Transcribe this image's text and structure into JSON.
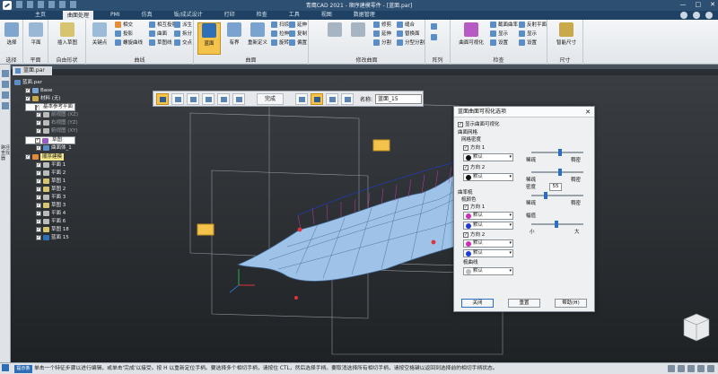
{
  "window": {
    "title": "青鹰CAD 2021 - 顺序建模零件 - [蓝面.par]",
    "controls": [
      "—",
      "□",
      "✕"
    ]
  },
  "ribbon_tabs": [
    "主页",
    "曲面处理",
    "PMI",
    "仿真",
    "钣/成式设计",
    "打印",
    "检查",
    "工具",
    "视图",
    "数据管理"
  ],
  "active_tab": "曲面处理",
  "ribbon": {
    "select": {
      "button": "选择",
      "group": "选择"
    },
    "plane": {
      "button": "平面",
      "group": "平面"
    },
    "sketch": {
      "button": "插入草图",
      "group": "自由形状"
    },
    "curves": {
      "items": [
        "相交",
        "投影",
        "螺旋曲线",
        "相互投影",
        "曲面",
        "草图线",
        "派生",
        "拆分",
        "交点",
        "关键点"
      ],
      "primary": "关键点",
      "group": "曲线"
    },
    "surfaces": {
      "buttons": [
        "蓝面",
        "有界",
        "重新定义"
      ],
      "items": [
        "扫掠",
        "拉伸",
        "旋转",
        "延伸",
        "复制",
        "偏置"
      ],
      "group": "曲面"
    },
    "modify": {
      "items": [
        "修剪",
        "延伸",
        "分割",
        "缝合",
        "替换面",
        "分型分割"
      ],
      "group": "修改曲面"
    },
    "pattern": {
      "group": "阵列"
    },
    "inspect": {
      "buttons": [
        "曲面可视化"
      ],
      "items": [
        "截面曲率",
        "显示",
        "设置",
        "反射平面",
        "显示",
        "设置"
      ],
      "group": "检查"
    },
    "dims": {
      "button": "智能尺寸",
      "group": "尺寸"
    }
  },
  "document_tab": "蓝面.par",
  "left_rail_text": "路径查找器",
  "tree": [
    {
      "label": "蓝面.par",
      "level": 0,
      "style": "normal"
    },
    {
      "label": "Base",
      "level": 1,
      "style": "normal"
    },
    {
      "label": "材料 (无)",
      "level": 1,
      "style": "normal"
    },
    {
      "label": "基本参考平面",
      "level": 1,
      "style": "sel"
    },
    {
      "label": "前视图 (XZ)",
      "level": 2,
      "style": "dim"
    },
    {
      "label": "右视图 (YZ)",
      "level": 2,
      "style": "dim"
    },
    {
      "label": "俯视图 (XY)",
      "level": 2,
      "style": "dim"
    },
    {
      "label": "草图",
      "level": 1,
      "style": "sel"
    },
    {
      "label": "曲面体_1",
      "level": 2,
      "style": "normal"
    },
    {
      "label": "顺序建模",
      "level": 1,
      "style": "hl"
    },
    {
      "label": "平面 1",
      "level": 2,
      "style": "normal"
    },
    {
      "label": "平面 2",
      "level": 2,
      "style": "normal"
    },
    {
      "label": "草图 1",
      "level": 2,
      "style": "normal"
    },
    {
      "label": "草图 2",
      "level": 2,
      "style": "normal"
    },
    {
      "label": "平面 3",
      "level": 2,
      "style": "normal"
    },
    {
      "label": "草图 3",
      "level": 2,
      "style": "normal"
    },
    {
      "label": "平面 4",
      "level": 2,
      "style": "normal"
    },
    {
      "label": "平面 6",
      "level": 2,
      "style": "normal"
    },
    {
      "label": "草图 18",
      "level": 2,
      "style": "normal"
    },
    {
      "label": "蓝面 15",
      "level": 2,
      "style": "normal"
    }
  ],
  "command_bar": {
    "finish": "完成",
    "name_label": "名称:",
    "name_value": "蓝面_15"
  },
  "dialog": {
    "title": "蓝面曲面可视化选项",
    "close": "✕",
    "show_visual": "显示曲面可视化",
    "mesh_section": "曲面网格",
    "mesh_density": "网格密度",
    "dir1": "方向 1",
    "dir2": "方向 2",
    "default": "默认",
    "sparse": "稀疏",
    "dense": "稠密",
    "curvature_section": "曲率梳",
    "comb_color": "梳颜色",
    "density": "密度",
    "density_value": "55",
    "magnitude": "幅值",
    "small": "小",
    "large": "大",
    "comb_curve": "梳曲线",
    "btn_close": "关闭",
    "btn_reset": "重置",
    "btn_help": "帮助(H)",
    "colors": {
      "black": "#111111",
      "magenta": "#d02bb8",
      "blue": "#1f3bd6",
      "gray": "#bdbdbd"
    }
  },
  "status": {
    "label": "提示条",
    "message": "单击一个特征步骤以进行编辑，或单击'完成'以接受。按 H 以重新定位手柄。要选择多个相切手柄，请按住 CTL，然后选择手柄。要取消选择所有相切手柄，请按空格键以返回到选择前的相切手柄状态。"
  }
}
